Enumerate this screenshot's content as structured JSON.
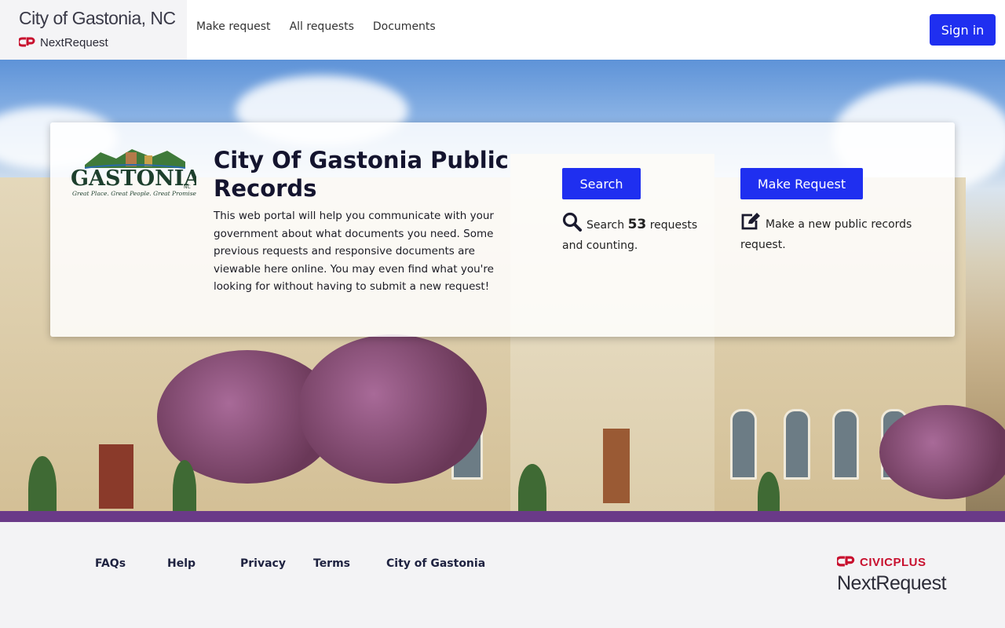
{
  "header": {
    "site_title": "City of Gastonia, NC",
    "product_name": "NextRequest",
    "nav": [
      {
        "label": "Make request"
      },
      {
        "label": "All requests"
      },
      {
        "label": "Documents"
      }
    ],
    "signin_label": "Sign in"
  },
  "hero": {
    "logo_text": "GASTONIA",
    "logo_state": "NC",
    "logo_tagline": "Great Place. Great People. Great Promise.",
    "title": "City Of Gastonia Public Records",
    "description": "This web portal will help you communicate with your government about what documents you need. Some previous requests and responsive documents are viewable here online. You may even find what you're looking for without having to submit a new request!",
    "search_button": "Search",
    "search_text_prefix": "Search",
    "request_count": "53",
    "search_text_suffix": "requests and counting.",
    "request_button": "Make Request",
    "request_text": "Make a new public records request."
  },
  "footer": {
    "links": [
      {
        "label": "FAQs"
      },
      {
        "label": "Help"
      },
      {
        "label": "Privacy"
      },
      {
        "label": "Terms"
      },
      {
        "label": "City of Gastonia"
      }
    ],
    "vendor": "CIVICPLUS",
    "product": "NextRequest"
  },
  "colors": {
    "primary_button": "#1f2ff0",
    "civicplus_red": "#c8102e"
  },
  "icons": [
    "civicplus-logo-icon",
    "search-icon",
    "edit-icon"
  ]
}
